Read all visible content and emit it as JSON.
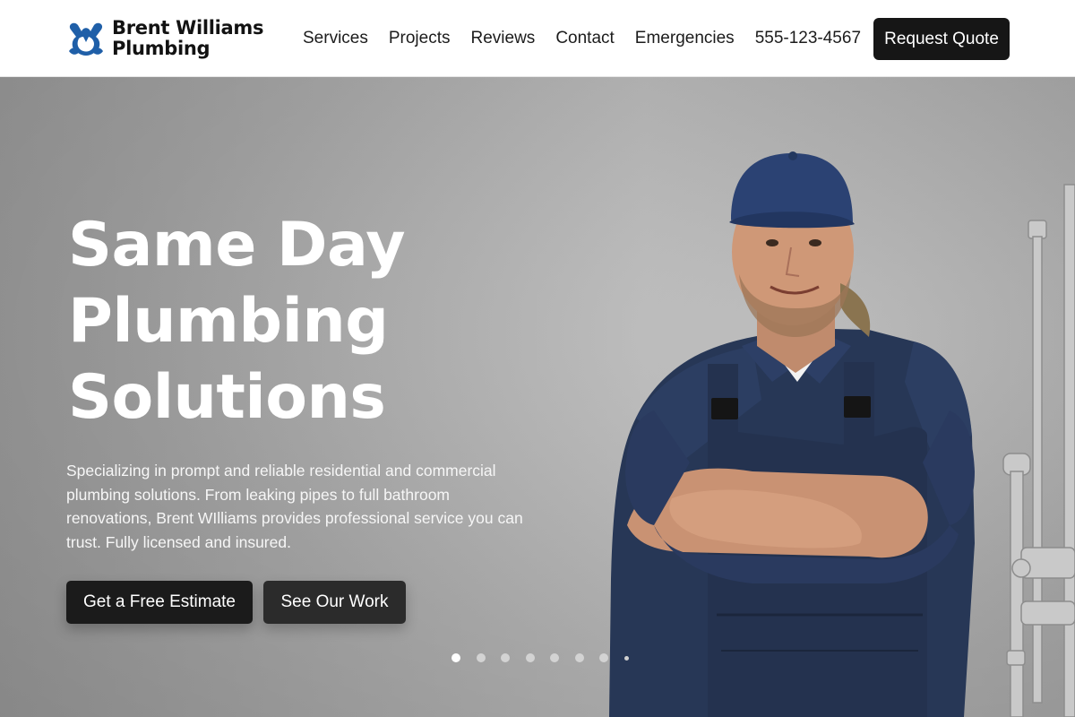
{
  "brand": {
    "line1": "Brent Williams",
    "line2": "Plumbing",
    "logo_icon": "wrench-pipe-logo-icon",
    "accent": "#1f5fa8"
  },
  "nav": {
    "items": [
      "Services",
      "Projects",
      "Reviews",
      "Contact",
      "Emergencies"
    ],
    "phone": "555-123-4567",
    "cta": "Request Quote"
  },
  "hero": {
    "title_lines": [
      "Same Day",
      "Plumbing",
      "Solutions"
    ],
    "description": "Specializing in prompt and reliable residential and commercial plumbing solutions. From leaking pipes to full bathroom renovations, Brent WIlliams provides professional service you can trust. Fully licensed and insured.",
    "primary_button": "Get a Free Estimate",
    "secondary_button": "See Our Work",
    "carousel": {
      "total": 8,
      "active": 1
    },
    "colors": {
      "uniform": "#27375c",
      "cap": "#2b4273",
      "background": "#a8a8a8"
    }
  }
}
